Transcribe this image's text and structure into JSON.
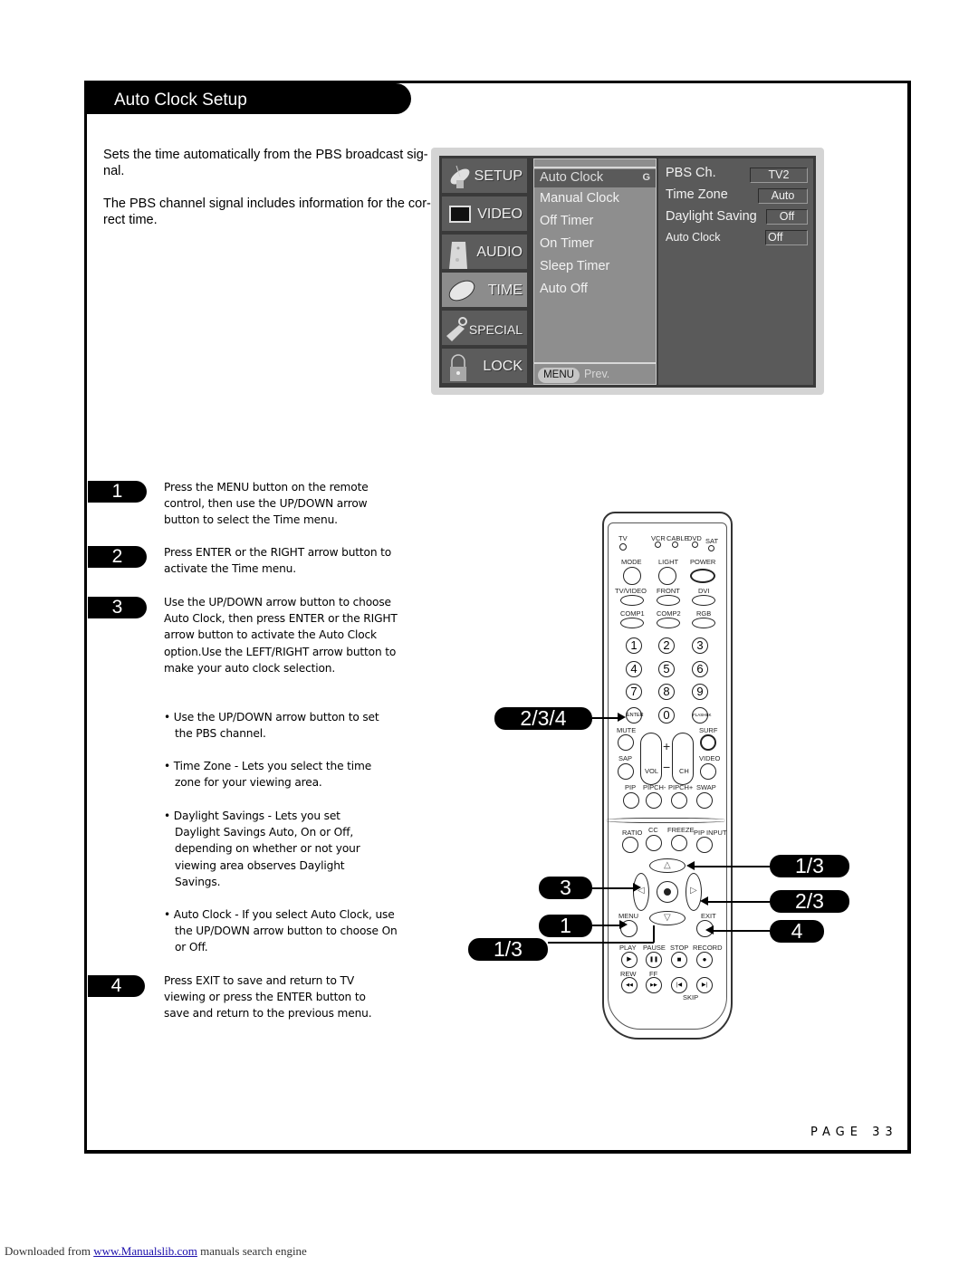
{
  "header": {
    "title": "Auto Clock Setup"
  },
  "intro": {
    "paragraph1_line1": "Sets the time automatically from the PBS broadcast sig-",
    "paragraph1_line2": "nal.",
    "paragraph2_line1": "The PBS channel signal includes information for the cor-",
    "paragraph2_line2": "rect time."
  },
  "osd": {
    "categories": [
      {
        "label": "SETUP",
        "icon": "satellite-dish-icon"
      },
      {
        "label": "VIDEO",
        "icon": "tv-screen-icon"
      },
      {
        "label": "AUDIO",
        "icon": "speaker-icon"
      },
      {
        "label": "TIME",
        "icon": "clock-disc-icon",
        "active": true
      },
      {
        "label": "SPECIAL",
        "icon": "tag-icon"
      },
      {
        "label": "LOCK",
        "icon": "padlock-icon"
      }
    ],
    "submenu": [
      {
        "label": "Auto Clock",
        "selected": true,
        "marker": "G"
      },
      {
        "label": "Manual Clock"
      },
      {
        "label": "Off Timer"
      },
      {
        "label": "On Timer"
      },
      {
        "label": "Sleep Timer"
      },
      {
        "label": "Auto Off"
      }
    ],
    "footer": {
      "menu_button": "MENU",
      "prev_label": "Prev."
    },
    "options": [
      {
        "label": "PBS Ch.",
        "value": "TV2"
      },
      {
        "label": "Time Zone",
        "value": "Auto"
      },
      {
        "label": "Daylight Saving",
        "value": "Off"
      },
      {
        "label": "Auto Clock",
        "value": "Off"
      }
    ]
  },
  "steps": [
    {
      "number": "1",
      "text": "Press the MENU button on the remote control, then use the UP/DOWN arrow button to select the Time menu."
    },
    {
      "number": "2",
      "text": "Press ENTER or the RIGHT arrow button to activate the Time menu."
    },
    {
      "number": "3",
      "text": "Use the UP/DOWN arrow button to choose Auto Clock, then press ENTER or the RIGHT arrow button to activate the Auto Clock option.Use the LEFT/RIGHT arrow button to make your auto clock selection."
    },
    {
      "number": "4",
      "text": "Press EXIT to save and return to TV viewing or press the ENTER button to save and return to the previous menu."
    }
  ],
  "bullets": [
    "• Use the UP/DOWN arrow button to set the PBS channel.",
    "• Time Zone - Lets you select the time zone for your viewing area.",
    "• Daylight Savings - Lets you set Daylight Savings Auto, On or Off, depending on whether or not your viewing area observes Daylight Savings.",
    "• Auto Clock - If you select Auto Clock, use the UP/DOWN arrow button  to choose On or Off."
  ],
  "callouts": {
    "enter": "2/3/4",
    "left": "3",
    "menu": "1",
    "down": "1/3",
    "up": "1/3",
    "right": "2/3",
    "exit": "4"
  },
  "remote": {
    "modes": [
      "TV",
      "VCR",
      "CABLE",
      "DVD",
      "SAT"
    ],
    "row1": [
      "MODE",
      "LIGHT",
      "POWER"
    ],
    "row2": [
      "TV/VIDEO",
      "FRONT",
      "DVI"
    ],
    "row3": [
      "COMP1",
      "COMP2",
      "RGB"
    ],
    "numbers": [
      "1",
      "2",
      "3",
      "4",
      "5",
      "6",
      "7",
      "8",
      "9"
    ],
    "enter": "ENTER",
    "zero": "0",
    "flashbk": "FLASHBK",
    "mute": "MUTE",
    "surf": "SURF",
    "sap": "SAP",
    "video": "VIDEO",
    "vol": "VOL",
    "ch": "CH",
    "plus": "+",
    "minus": "−",
    "pip_row": [
      "PIP",
      "PIPCH-",
      "PIPCH+",
      "SWAP"
    ],
    "func_row": [
      "RATIO",
      "CC",
      "FREEZE",
      "PIP INPUT"
    ],
    "up": "△",
    "down": "▽",
    "left": "◁",
    "right": "▷",
    "menu": "MENU",
    "exit": "EXIT",
    "transport_labels": [
      "PLAY",
      "PAUSE",
      "STOP",
      "RECORD"
    ],
    "transport_icons": [
      "▶",
      "❚❚",
      "■",
      "●"
    ],
    "rew": "REW",
    "ff": "FF",
    "skip_icons": [
      "◀◀",
      "▶▶",
      "|◀",
      "▶|"
    ],
    "skip": "SKIP"
  },
  "page": {
    "label": "PAGE 33"
  },
  "footer": {
    "prefix": "Downloaded from ",
    "link": "www.Manualslib.com",
    "suffix": " manuals search engine"
  }
}
